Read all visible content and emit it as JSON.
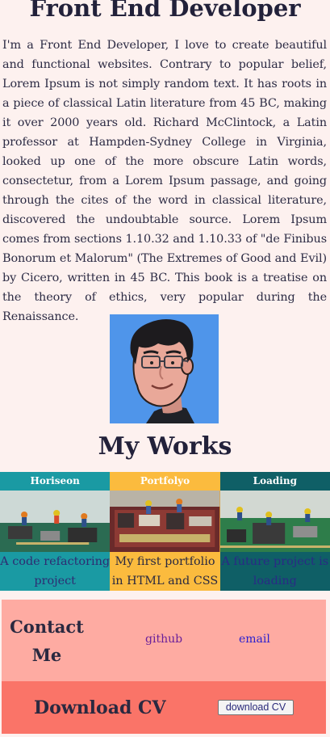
{
  "header": {
    "title": "Front End Developer"
  },
  "bio": {
    "text": "I'm a Front End Developer, I love to create beautiful and functional websites. Contrary to popular belief, Lorem Ipsum is not simply random text. It has roots in a piece of classical Latin literature from 45 BC, making it over 2000 years old. Richard McClintock, a Latin professor at Hampden-Sydney College in Virginia, looked up one of the more obscure Latin words, consectetur, from a Lorem Ipsum passage, and going through the cites of the word in classical literature, discovered the undoubtable source. Lorem Ipsum comes from sections 1.10.32 and 1.10.33 of \"de Finibus Bonorum et Malorum\" (The Extremes of Good and Evil) by Cicero, written in 45 BC. This book is a treatise on the theory of ethics, very popular during the Renaissance."
  },
  "avatar": {
    "background": "#4f95ea"
  },
  "works": {
    "title": "My Works",
    "items": [
      {
        "label": "Horiseon",
        "description": "A code refactoring project",
        "color": "#1a9aa3",
        "desc_text_color": "#2e2c72"
      },
      {
        "label": "Portfolyo",
        "description": "My first portfolio in HTML and CSS",
        "color": "#fbbb3e",
        "desc_text_color": "#2a2940"
      },
      {
        "label": "Loading",
        "description": "A future project is loading",
        "color": "#0f5f66",
        "desc_text_color": "#2a2a85"
      }
    ]
  },
  "contact": {
    "title": "Contact Me",
    "github": "github",
    "email": "email",
    "background": "#feaba2"
  },
  "download": {
    "title": "Download CV",
    "button": "download CV",
    "background": "#fa7468"
  }
}
